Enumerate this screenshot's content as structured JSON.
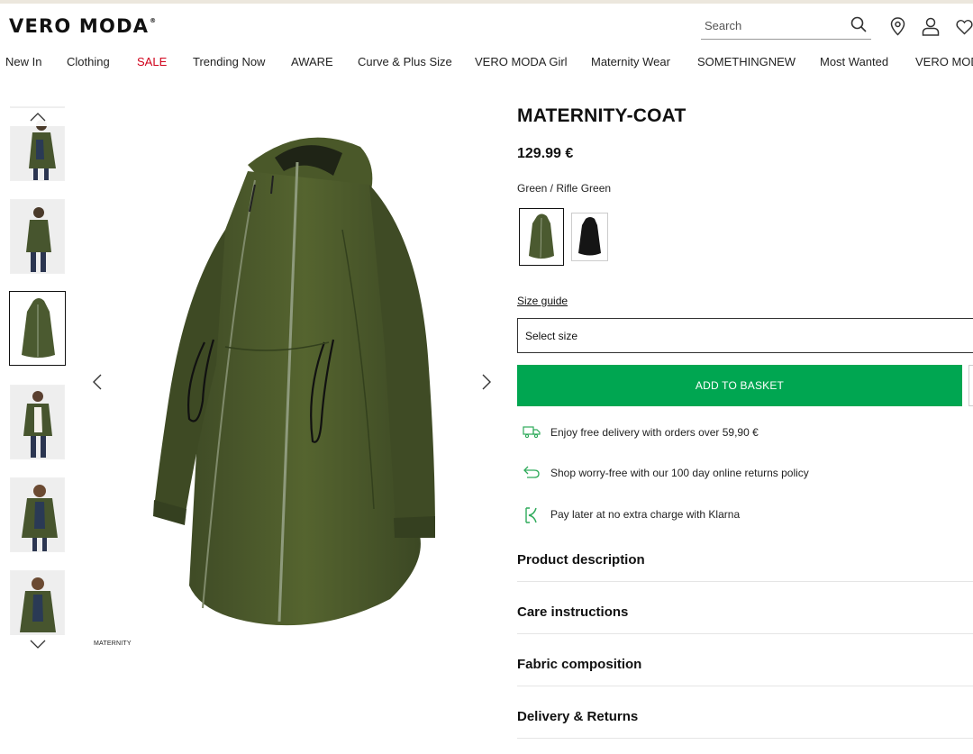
{
  "brand": {
    "logo": "VERO MODA",
    "trademark": "®"
  },
  "search": {
    "placeholder": "Search"
  },
  "header_icons": [
    "search-icon",
    "location-pin-icon",
    "account-icon",
    "heart-icon"
  ],
  "nav": {
    "items": [
      {
        "label": "New In"
      },
      {
        "label": "Clothing"
      },
      {
        "label": "SALE"
      },
      {
        "label": "Trending Now"
      },
      {
        "label": "AWARE"
      },
      {
        "label": "Curve & Plus Size"
      },
      {
        "label": "VERO MODA Girl"
      },
      {
        "label": "Maternity Wear"
      },
      {
        "label": "SOMETHINGNEW"
      },
      {
        "label": "Most Wanted"
      },
      {
        "label": "VERO MOD"
      }
    ],
    "sale_color": "#d0021b"
  },
  "gallery": {
    "thumbnail_count": 6,
    "active_thumbnail": 3,
    "image_caption": "MATERNITY"
  },
  "product": {
    "title": "MATERNITY-COAT",
    "price": "129.99 €",
    "color_label": "Green / Rifle Green",
    "colors": [
      {
        "name": "Rifle Green",
        "hex": "#4b5a30",
        "selected": true
      },
      {
        "name": "Black",
        "hex": "#151515",
        "selected": false
      }
    ],
    "size_guide": "Size guide",
    "size_placeholder": "Select size",
    "add_to_basket": "ADD TO BASKET",
    "accent": "#00a651"
  },
  "perks": [
    {
      "icon": "delivery-truck-icon",
      "text": "Enjoy free delivery with orders over 59,90 €"
    },
    {
      "icon": "return-arrow-icon",
      "text": "Shop worry-free with our 100 day online returns policy"
    },
    {
      "icon": "klarna-icon",
      "text": "Pay later at no extra charge with Klarna"
    }
  ],
  "accordions": [
    {
      "label": "Product description"
    },
    {
      "label": "Care instructions"
    },
    {
      "label": "Fabric composition"
    },
    {
      "label": "Delivery & Returns"
    }
  ]
}
